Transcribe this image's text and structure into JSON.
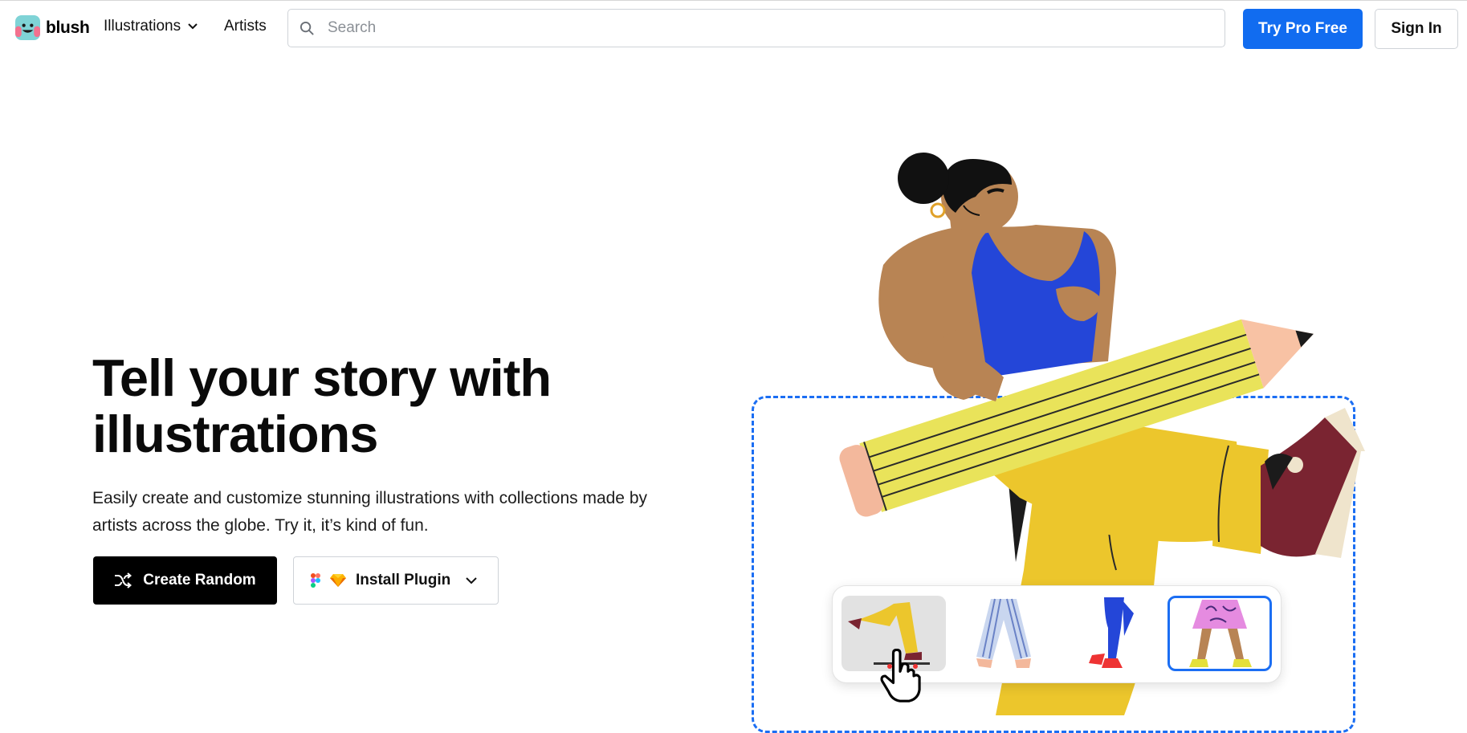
{
  "nav": {
    "logo_text": "blush",
    "illustrations_label": "Illustrations",
    "artists_label": "Artists",
    "search_placeholder": "Search",
    "try_pro_label": "Try Pro Free",
    "sign_in_label": "Sign In"
  },
  "hero": {
    "title": "Tell your story with illustrations",
    "subtitle": "Easily create and customize stunning illustrations with collections made by artists across the globe. Try it, it’s kind of fun.",
    "create_random_label": "Create Random",
    "install_plugin_label": "Install Plugin"
  },
  "icons": {
    "search": "search-icon",
    "chevron": "chevron-down-icon",
    "shuffle": "shuffle-icon",
    "figma": "figma-icon",
    "sketch": "sketch-icon",
    "cursor": "hand-cursor-icon"
  },
  "colors": {
    "accent_blue": "#116cf0",
    "black_button": "#000000",
    "pants_yellow": "#ecc62c",
    "shirt_blue": "#2446d8",
    "skin": "#b88454",
    "pencil_yellow": "#e9e35a",
    "shoe_maroon": "#7a2431"
  },
  "illustration_picker": {
    "options": [
      "yellow-pants-skateboard",
      "striped-pants",
      "blue-jeans-red-shoes",
      "pink-skirt-selected"
    ],
    "selected_index": 3
  }
}
